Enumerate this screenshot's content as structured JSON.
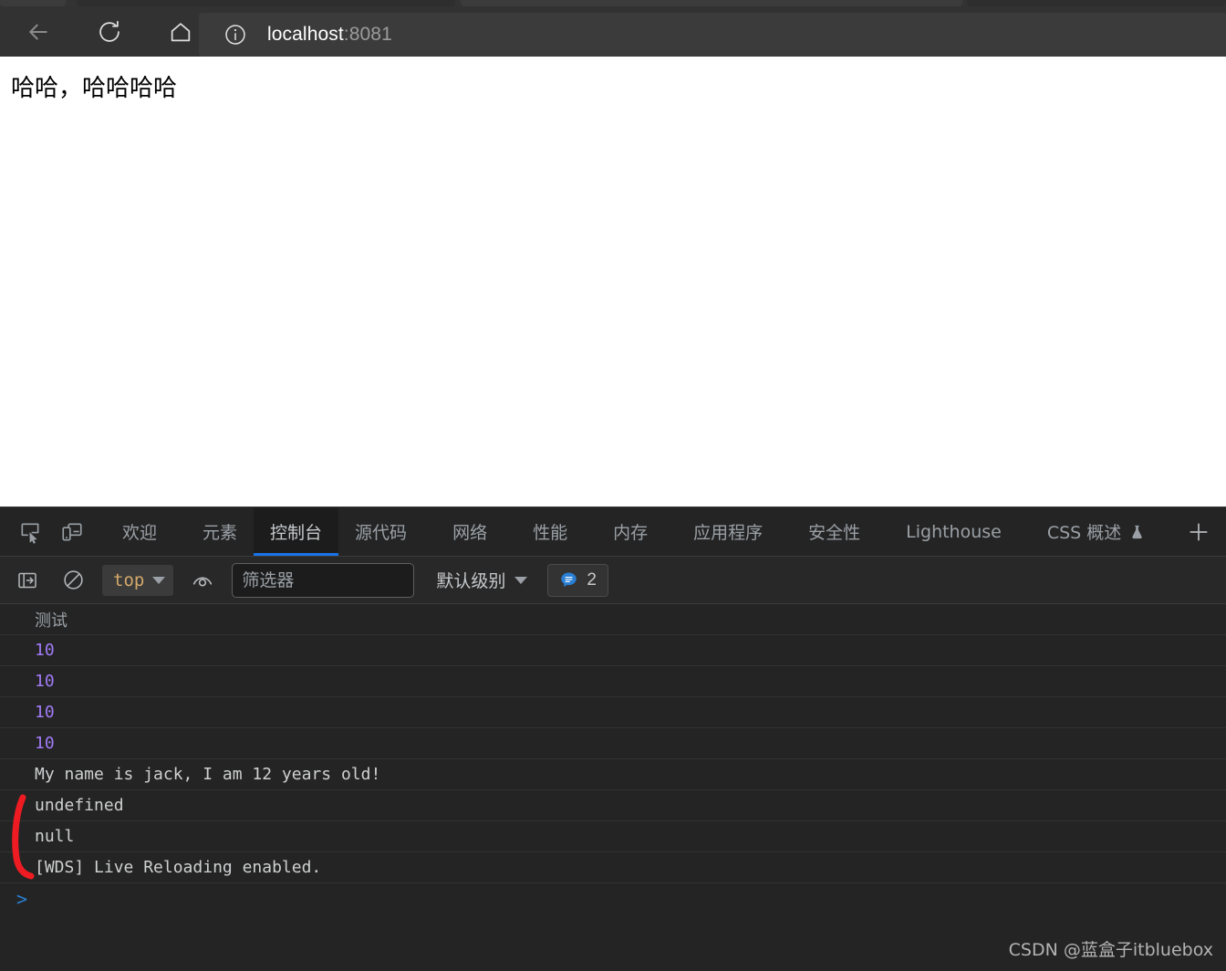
{
  "browser": {
    "nav": {
      "back_icon": "arrow-left-icon",
      "reload_icon": "reload-icon",
      "home_icon": "home-icon"
    },
    "omnibox": {
      "info_icon": "info-circle-icon",
      "host": "localhost",
      "port": ":8081"
    }
  },
  "page": {
    "body_text": "哈哈，哈哈哈哈"
  },
  "devtools": {
    "panel_icons": [
      {
        "name": "inspect-element-icon"
      },
      {
        "name": "device-toolbar-icon"
      }
    ],
    "tabs": [
      {
        "label": "欢迎",
        "active": false
      },
      {
        "label": "元素",
        "active": false
      },
      {
        "label": "控制台",
        "active": true
      },
      {
        "label": "源代码",
        "active": false
      },
      {
        "label": "网络",
        "active": false
      },
      {
        "label": "性能",
        "active": false
      },
      {
        "label": "内存",
        "active": false
      },
      {
        "label": "应用程序",
        "active": false
      },
      {
        "label": "安全性",
        "active": false
      },
      {
        "label": "Lighthouse",
        "active": false
      },
      {
        "label": "CSS 概述",
        "active": false,
        "experimental_icon": "flask-icon"
      }
    ],
    "more_tabs_label": "+",
    "console_toolbar": {
      "sidebar_toggle_icon": "console-sidebar-toggle-icon",
      "clear_console_icon": "clear-console-icon",
      "context_value": "top",
      "live_expression_icon": "eye-icon",
      "filter_placeholder": "筛选器",
      "filter_value": "",
      "levels_label": "默认级别",
      "message_badge": {
        "icon": "speech-bubble-icon",
        "count": "2",
        "color": "#2a7fd4"
      }
    },
    "console_log": [
      {
        "text": "测试",
        "kind": "cn-text"
      },
      {
        "text": "10",
        "kind": "number"
      },
      {
        "text": "10",
        "kind": "number"
      },
      {
        "text": "10",
        "kind": "number"
      },
      {
        "text": "10",
        "kind": "number"
      },
      {
        "text": "My name is jack, I am 12 years old!",
        "kind": "text"
      },
      {
        "text": "undefined",
        "kind": "text"
      },
      {
        "text": "null",
        "kind": "text"
      },
      {
        "text": "[WDS] Live Reloading enabled.",
        "kind": "text"
      }
    ],
    "prompt_chevron": ">"
  },
  "annotation": {
    "shape": "red-bracket-mark",
    "color": "#ee1c22"
  },
  "watermark": {
    "text": "CSDN @蓝盒子itbluebox"
  },
  "colors": {
    "accent_blue": "#1a73e8",
    "number_purple": "#a07bf5",
    "context_orange": "#d4a96a",
    "devtools_bg": "#242424"
  }
}
